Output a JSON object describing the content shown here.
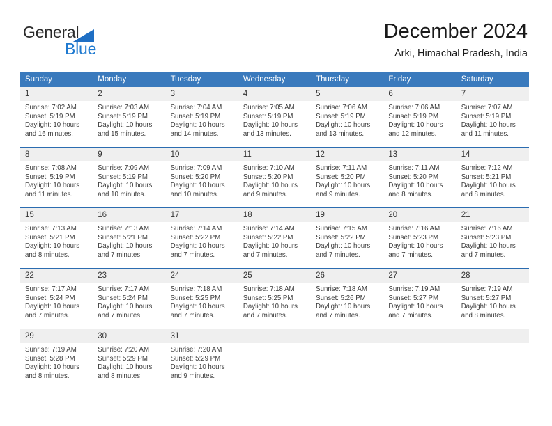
{
  "brand": {
    "name_part1": "General",
    "name_part2": "Blue",
    "triangle_color": "#1f6fc4",
    "blue_color": "#1f7ad0"
  },
  "header": {
    "title": "December 2024",
    "subtitle": "Arki, Himachal Pradesh, India"
  },
  "calendar": {
    "accent_color": "#3a7abd",
    "rule_color": "#2b6cb0",
    "daynum_bg": "#efefef",
    "weekday_headers": [
      "Sunday",
      "Monday",
      "Tuesday",
      "Wednesday",
      "Thursday",
      "Friday",
      "Saturday"
    ],
    "weeks": [
      [
        {
          "day": "1",
          "sunrise": "Sunrise: 7:02 AM",
          "sunset": "Sunset: 5:19 PM",
          "daylight1": "Daylight: 10 hours",
          "daylight2": "and 16 minutes."
        },
        {
          "day": "2",
          "sunrise": "Sunrise: 7:03 AM",
          "sunset": "Sunset: 5:19 PM",
          "daylight1": "Daylight: 10 hours",
          "daylight2": "and 15 minutes."
        },
        {
          "day": "3",
          "sunrise": "Sunrise: 7:04 AM",
          "sunset": "Sunset: 5:19 PM",
          "daylight1": "Daylight: 10 hours",
          "daylight2": "and 14 minutes."
        },
        {
          "day": "4",
          "sunrise": "Sunrise: 7:05 AM",
          "sunset": "Sunset: 5:19 PM",
          "daylight1": "Daylight: 10 hours",
          "daylight2": "and 13 minutes."
        },
        {
          "day": "5",
          "sunrise": "Sunrise: 7:06 AM",
          "sunset": "Sunset: 5:19 PM",
          "daylight1": "Daylight: 10 hours",
          "daylight2": "and 13 minutes."
        },
        {
          "day": "6",
          "sunrise": "Sunrise: 7:06 AM",
          "sunset": "Sunset: 5:19 PM",
          "daylight1": "Daylight: 10 hours",
          "daylight2": "and 12 minutes."
        },
        {
          "day": "7",
          "sunrise": "Sunrise: 7:07 AM",
          "sunset": "Sunset: 5:19 PM",
          "daylight1": "Daylight: 10 hours",
          "daylight2": "and 11 minutes."
        }
      ],
      [
        {
          "day": "8",
          "sunrise": "Sunrise: 7:08 AM",
          "sunset": "Sunset: 5:19 PM",
          "daylight1": "Daylight: 10 hours",
          "daylight2": "and 11 minutes."
        },
        {
          "day": "9",
          "sunrise": "Sunrise: 7:09 AM",
          "sunset": "Sunset: 5:19 PM",
          "daylight1": "Daylight: 10 hours",
          "daylight2": "and 10 minutes."
        },
        {
          "day": "10",
          "sunrise": "Sunrise: 7:09 AM",
          "sunset": "Sunset: 5:20 PM",
          "daylight1": "Daylight: 10 hours",
          "daylight2": "and 10 minutes."
        },
        {
          "day": "11",
          "sunrise": "Sunrise: 7:10 AM",
          "sunset": "Sunset: 5:20 PM",
          "daylight1": "Daylight: 10 hours",
          "daylight2": "and 9 minutes."
        },
        {
          "day": "12",
          "sunrise": "Sunrise: 7:11 AM",
          "sunset": "Sunset: 5:20 PM",
          "daylight1": "Daylight: 10 hours",
          "daylight2": "and 9 minutes."
        },
        {
          "day": "13",
          "sunrise": "Sunrise: 7:11 AM",
          "sunset": "Sunset: 5:20 PM",
          "daylight1": "Daylight: 10 hours",
          "daylight2": "and 8 minutes."
        },
        {
          "day": "14",
          "sunrise": "Sunrise: 7:12 AM",
          "sunset": "Sunset: 5:21 PM",
          "daylight1": "Daylight: 10 hours",
          "daylight2": "and 8 minutes."
        }
      ],
      [
        {
          "day": "15",
          "sunrise": "Sunrise: 7:13 AM",
          "sunset": "Sunset: 5:21 PM",
          "daylight1": "Daylight: 10 hours",
          "daylight2": "and 8 minutes."
        },
        {
          "day": "16",
          "sunrise": "Sunrise: 7:13 AM",
          "sunset": "Sunset: 5:21 PM",
          "daylight1": "Daylight: 10 hours",
          "daylight2": "and 7 minutes."
        },
        {
          "day": "17",
          "sunrise": "Sunrise: 7:14 AM",
          "sunset": "Sunset: 5:22 PM",
          "daylight1": "Daylight: 10 hours",
          "daylight2": "and 7 minutes."
        },
        {
          "day": "18",
          "sunrise": "Sunrise: 7:14 AM",
          "sunset": "Sunset: 5:22 PM",
          "daylight1": "Daylight: 10 hours",
          "daylight2": "and 7 minutes."
        },
        {
          "day": "19",
          "sunrise": "Sunrise: 7:15 AM",
          "sunset": "Sunset: 5:22 PM",
          "daylight1": "Daylight: 10 hours",
          "daylight2": "and 7 minutes."
        },
        {
          "day": "20",
          "sunrise": "Sunrise: 7:16 AM",
          "sunset": "Sunset: 5:23 PM",
          "daylight1": "Daylight: 10 hours",
          "daylight2": "and 7 minutes."
        },
        {
          "day": "21",
          "sunrise": "Sunrise: 7:16 AM",
          "sunset": "Sunset: 5:23 PM",
          "daylight1": "Daylight: 10 hours",
          "daylight2": "and 7 minutes."
        }
      ],
      [
        {
          "day": "22",
          "sunrise": "Sunrise: 7:17 AM",
          "sunset": "Sunset: 5:24 PM",
          "daylight1": "Daylight: 10 hours",
          "daylight2": "and 7 minutes."
        },
        {
          "day": "23",
          "sunrise": "Sunrise: 7:17 AM",
          "sunset": "Sunset: 5:24 PM",
          "daylight1": "Daylight: 10 hours",
          "daylight2": "and 7 minutes."
        },
        {
          "day": "24",
          "sunrise": "Sunrise: 7:18 AM",
          "sunset": "Sunset: 5:25 PM",
          "daylight1": "Daylight: 10 hours",
          "daylight2": "and 7 minutes."
        },
        {
          "day": "25",
          "sunrise": "Sunrise: 7:18 AM",
          "sunset": "Sunset: 5:25 PM",
          "daylight1": "Daylight: 10 hours",
          "daylight2": "and 7 minutes."
        },
        {
          "day": "26",
          "sunrise": "Sunrise: 7:18 AM",
          "sunset": "Sunset: 5:26 PM",
          "daylight1": "Daylight: 10 hours",
          "daylight2": "and 7 minutes."
        },
        {
          "day": "27",
          "sunrise": "Sunrise: 7:19 AM",
          "sunset": "Sunset: 5:27 PM",
          "daylight1": "Daylight: 10 hours",
          "daylight2": "and 7 minutes."
        },
        {
          "day": "28",
          "sunrise": "Sunrise: 7:19 AM",
          "sunset": "Sunset: 5:27 PM",
          "daylight1": "Daylight: 10 hours",
          "daylight2": "and 8 minutes."
        }
      ],
      [
        {
          "day": "29",
          "sunrise": "Sunrise: 7:19 AM",
          "sunset": "Sunset: 5:28 PM",
          "daylight1": "Daylight: 10 hours",
          "daylight2": "and 8 minutes."
        },
        {
          "day": "30",
          "sunrise": "Sunrise: 7:20 AM",
          "sunset": "Sunset: 5:29 PM",
          "daylight1": "Daylight: 10 hours",
          "daylight2": "and 8 minutes."
        },
        {
          "day": "31",
          "sunrise": "Sunrise: 7:20 AM",
          "sunset": "Sunset: 5:29 PM",
          "daylight1": "Daylight: 10 hours",
          "daylight2": "and 9 minutes."
        },
        {
          "day": "",
          "sunrise": "",
          "sunset": "",
          "daylight1": "",
          "daylight2": "",
          "empty": true
        },
        {
          "day": "",
          "sunrise": "",
          "sunset": "",
          "daylight1": "",
          "daylight2": "",
          "empty": true
        },
        {
          "day": "",
          "sunrise": "",
          "sunset": "",
          "daylight1": "",
          "daylight2": "",
          "empty": true
        },
        {
          "day": "",
          "sunrise": "",
          "sunset": "",
          "daylight1": "",
          "daylight2": "",
          "empty": true
        }
      ]
    ]
  }
}
